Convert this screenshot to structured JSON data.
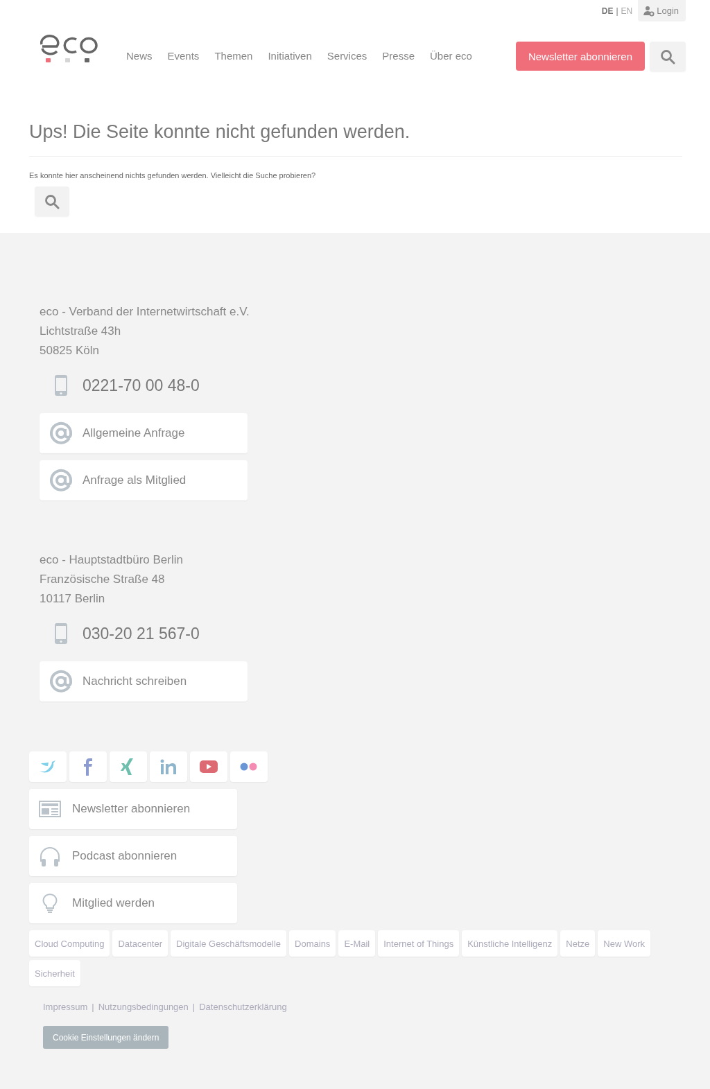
{
  "top_bar": {
    "languages": [
      {
        "label": "DE",
        "selected": true
      },
      {
        "label": "EN",
        "selected": false
      }
    ],
    "language_separator": "|",
    "login": "Login"
  },
  "nav": [
    {
      "label": "News"
    },
    {
      "label": "Events"
    },
    {
      "label": "Themen"
    },
    {
      "label": "Initiativen"
    },
    {
      "label": "Services"
    },
    {
      "label": "Presse"
    },
    {
      "label": "Über eco"
    }
  ],
  "cta": "Newsletter abonnieren",
  "heading": "Ups! Die Seite konnte nicht gefunden werden.",
  "message": "Es konnte hier anscheinend nichts gefunden werden. Vielleicht die Suche probieren?",
  "offices": [
    {
      "lines": [
        "eco - Verband der Internetwirtschaft e.V.",
        "Lichtstraße 43h",
        "50825 Köln"
      ],
      "phone": "0221-70 00 48-0",
      "contacts": [
        "Allgemeine Anfrage",
        "Anfrage als Mitglied"
      ]
    },
    {
      "lines": [
        "eco - Hauptstadtbüro Berlin",
        "Französische Straße 48",
        "10117 Berlin"
      ],
      "phone": "030-20 21 567-0",
      "contacts": [
        "Nachricht schreiben"
      ]
    }
  ],
  "social": [
    {
      "kind": "twitter",
      "color": "#7fd0ea"
    },
    {
      "kind": "facebook",
      "color": "#8c9bd0"
    },
    {
      "kind": "xing",
      "color": "#6fbfae"
    },
    {
      "kind": "linkedin",
      "color": "#8fb5cc"
    },
    {
      "kind": "youtube",
      "color": "#dd6a72"
    },
    {
      "kind": "flickr",
      "color": "#6b96d6"
    }
  ],
  "links": [
    {
      "kind": "newsletter",
      "label": "Newsletter abonnieren"
    },
    {
      "kind": "podcast",
      "label": "Podcast abonnieren"
    },
    {
      "kind": "member",
      "label": "Mitglied werden"
    }
  ],
  "tags": [
    "Cloud Computing",
    "Datacenter",
    "Digitale Geschäftsmodelle",
    "Domains",
    "E-Mail",
    "Internet of Things",
    "Künstliche Intelligenz",
    "Netze",
    "New Work",
    "Sicherheit"
  ],
  "legal": {
    "links": [
      "Impressum",
      "Nutzungsbedingungen",
      "Datenschutzerklärung"
    ],
    "separator": "|"
  },
  "cookie_button": "Cookie Einstellungen ändern"
}
